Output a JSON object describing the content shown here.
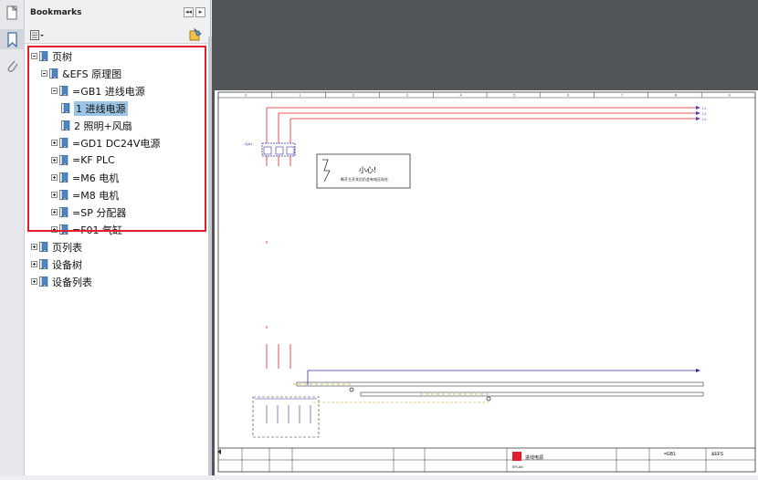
{
  "panel": {
    "title": "Bookmarks",
    "collapse_label": "◂◂",
    "expand_label": "▸"
  },
  "tree": {
    "items": [
      {
        "label": "页树",
        "level": 0,
        "expanded": true
      },
      {
        "label": "&EFS 原理图",
        "level": 1,
        "expanded": true
      },
      {
        "label": "=GB1 进线电源",
        "level": 2,
        "expanded": true
      },
      {
        "label": "1 进线电源",
        "level": 3,
        "selected": true
      },
      {
        "label": "2 照明+风扇",
        "level": 3
      },
      {
        "label": "=GD1 DC24V电源",
        "level": 2
      },
      {
        "label": "=KF PLC",
        "level": 2
      },
      {
        "label": "=M6 电机",
        "level": 2
      },
      {
        "label": "=M8 电机",
        "level": 2
      },
      {
        "label": "=SP 分配器",
        "level": 2
      },
      {
        "label": "=F01 气缸",
        "level": 2
      },
      {
        "label": "页列表",
        "level": 0
      },
      {
        "label": "设备树",
        "level": 0
      },
      {
        "label": "设备列表",
        "level": 0
      }
    ]
  },
  "drawing": {
    "col_numbers": [
      "0",
      "1",
      "2",
      "3",
      "4",
      "5",
      "6",
      "7",
      "8",
      "9"
    ],
    "device_tag": "-QA1",
    "warning_title": "小心!",
    "warning_text": "断开主开关后仍会有电压存在",
    "line_labels": [
      "L1",
      "L2",
      "L3"
    ],
    "title_block_name": "进线电源",
    "title_block_code": "=GB1",
    "title_block_loc": "&EFS",
    "company": "EPLAN"
  },
  "colors": {
    "accent_red": "#e1202a",
    "selection": "#9cc4e4",
    "viewer_bg": "#525659"
  }
}
